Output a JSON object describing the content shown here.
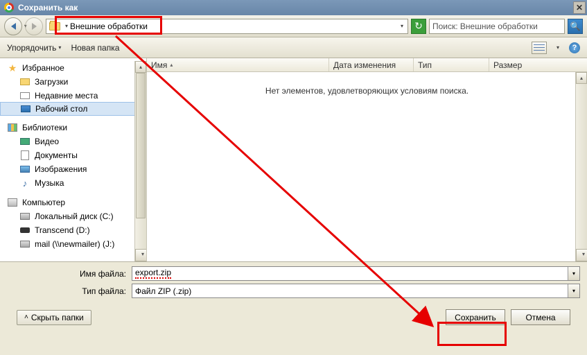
{
  "window": {
    "title": "Сохранить как"
  },
  "breadcrumb": {
    "path": "Внешние обработки"
  },
  "search": {
    "placeholder": "Поиск: Внешние обработки"
  },
  "toolbar": {
    "organize": "Упорядочить",
    "new_folder": "Новая папка"
  },
  "columns": {
    "name": "Имя",
    "modified": "Дата изменения",
    "type": "Тип",
    "size": "Размер"
  },
  "content": {
    "empty_msg": "Нет элементов, удовлетворяющих условиям поиска."
  },
  "sidebar": {
    "favorites": {
      "label": "Избранное",
      "items": [
        "Загрузки",
        "Недавние места",
        "Рабочий стол"
      ]
    },
    "libraries": {
      "label": "Библиотеки",
      "items": [
        "Видео",
        "Документы",
        "Изображения",
        "Музыка"
      ]
    },
    "computer": {
      "label": "Компьютер",
      "items": [
        "Локальный диск (C:)",
        "Transcend (D:)",
        "mail (\\\\newmailer) (J:)"
      ]
    }
  },
  "fields": {
    "filename_label": "Имя файла:",
    "filename_value": "export.zip",
    "filetype_label": "Тип файла:",
    "filetype_value": "Файл ZIP (.zip)"
  },
  "buttons": {
    "hide_folders": "Скрыть папки",
    "save": "Сохранить",
    "cancel": "Отмена"
  }
}
